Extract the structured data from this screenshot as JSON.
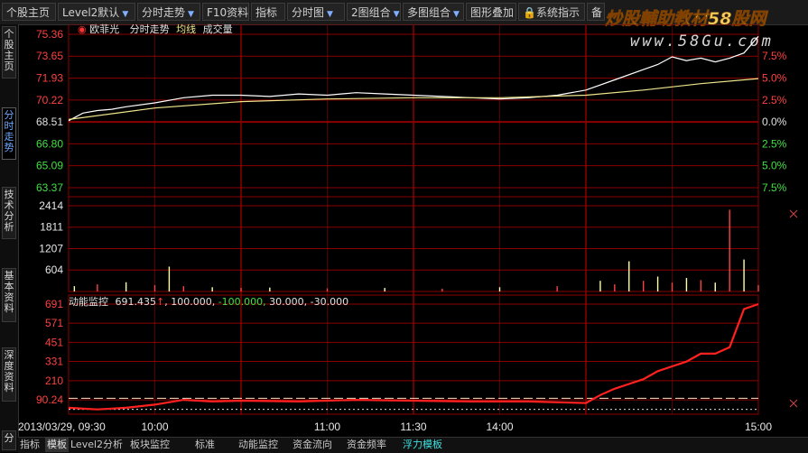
{
  "toolbar": {
    "home_label": "个股主页",
    "level2_label": "Level2默认",
    "timeshare_label": "分时走势",
    "f10_label": "F10资料",
    "indicator_label": "指标",
    "chart_label": "分时图",
    "combo2_label": "2图组合",
    "multicombo_label": "多图组合",
    "overlay_label": "图形叠加",
    "system_label": "系统指示",
    "extra_label": "备"
  },
  "watermark": {
    "brand": "炒股輔助教材58股网",
    "url": "www.58Gu.com"
  },
  "sidebar": {
    "items": [
      {
        "label": "个股主页"
      },
      {
        "label": "分时走势"
      },
      {
        "label": "技术分析"
      },
      {
        "label": "基本资料"
      },
      {
        "label": "深度资料"
      },
      {
        "label": "分"
      }
    ]
  },
  "stock": {
    "name": "欧菲光",
    "view": "分时走势",
    "avg_line": "均线",
    "volume": "成交量"
  },
  "price_axis": {
    "labels": [
      "75.36",
      "73.65",
      "71.93",
      "70.22",
      "68.51",
      "66.80",
      "65.09",
      "63.37"
    ],
    "pct_labels": [
      "7.5%",
      "5.0%",
      "2.5%",
      "0.0%",
      "2.5%",
      "5.0%",
      "7.5%"
    ]
  },
  "volume_axis": {
    "labels": [
      "2414",
      "1811",
      "1207",
      "604"
    ]
  },
  "indicator": {
    "title": "动能监控",
    "value": "691.435",
    "arrow": "↑",
    "p1": "100.000,",
    "p2": "-100.000,",
    "p3": "30.000,",
    "p4": "-30.000",
    "labels": [
      "691",
      "571",
      "451",
      "331",
      "210",
      "90.24"
    ]
  },
  "time_axis": {
    "date": "2013/03/29, 09:30",
    "labels": [
      "10:00",
      "11:00",
      "11:30",
      "14:00",
      "15:00"
    ]
  },
  "statusbar": {
    "items": [
      "指标",
      "模板",
      "Level2分析",
      "板块监控",
      "标准",
      "动能监控",
      "资金流向",
      "资金频率",
      "浮力模板"
    ]
  },
  "colors": {
    "price_line": "#ffffff",
    "avg_line": "#f0e68c",
    "grid": "#8b0000",
    "up": "#ff4040",
    "down": "#40e040",
    "indicator_line": "#ff2020",
    "accent": "#6fa8ff"
  },
  "chart_data": {
    "type": "line",
    "x_unit": "minutes since 09:30 open",
    "price": {
      "ylim": [
        63.37,
        75.36
      ],
      "prev_close": 68.51,
      "series": [
        {
          "x": [
            0,
            5,
            10,
            15,
            20,
            30,
            40,
            50,
            60,
            70,
            80,
            90,
            100,
            110,
            120,
            130,
            140,
            150,
            160,
            170,
            180,
            190,
            200,
            205,
            210,
            215,
            220,
            225,
            230,
            235,
            240
          ],
          "values": [
            68.6,
            69.2,
            69.4,
            69.5,
            69.7,
            70.0,
            70.4,
            70.6,
            70.6,
            70.5,
            70.7,
            70.6,
            70.8,
            70.7,
            70.6,
            70.5,
            70.4,
            70.3,
            70.4,
            70.6,
            71.0,
            71.8,
            72.6,
            73.0,
            73.6,
            73.3,
            73.5,
            73.2,
            73.5,
            73.9,
            75.2
          ]
        },
        {
          "x": [
            0,
            30,
            60,
            90,
            120,
            150,
            180,
            200,
            220,
            240
          ],
          "values": [
            68.7,
            69.6,
            70.1,
            70.3,
            70.4,
            70.4,
            70.6,
            71.0,
            71.5,
            71.9
          ]
        }
      ]
    },
    "volume": {
      "ylim": [
        0,
        2414
      ],
      "x": [
        2,
        10,
        20,
        30,
        35,
        40,
        50,
        60,
        70,
        90,
        110,
        130,
        150,
        170,
        185,
        190,
        195,
        200,
        205,
        210,
        215,
        220,
        225,
        230,
        235,
        240
      ],
      "values": [
        150,
        200,
        260,
        180,
        700,
        150,
        120,
        100,
        110,
        90,
        100,
        80,
        120,
        150,
        300,
        200,
        850,
        300,
        420,
        250,
        380,
        320,
        250,
        2300,
        900,
        180
      ]
    },
    "indicator": {
      "ylim": [
        0,
        691
      ],
      "x": [
        0,
        10,
        20,
        30,
        40,
        50,
        60,
        80,
        100,
        120,
        140,
        160,
        180,
        185,
        190,
        195,
        200,
        205,
        210,
        215,
        220,
        225,
        230,
        235,
        240
      ],
      "values": [
        40,
        30,
        40,
        60,
        90,
        80,
        85,
        80,
        90,
        85,
        80,
        80,
        70,
        120,
        160,
        190,
        220,
        270,
        300,
        330,
        380,
        380,
        420,
        660,
        691
      ]
    }
  }
}
